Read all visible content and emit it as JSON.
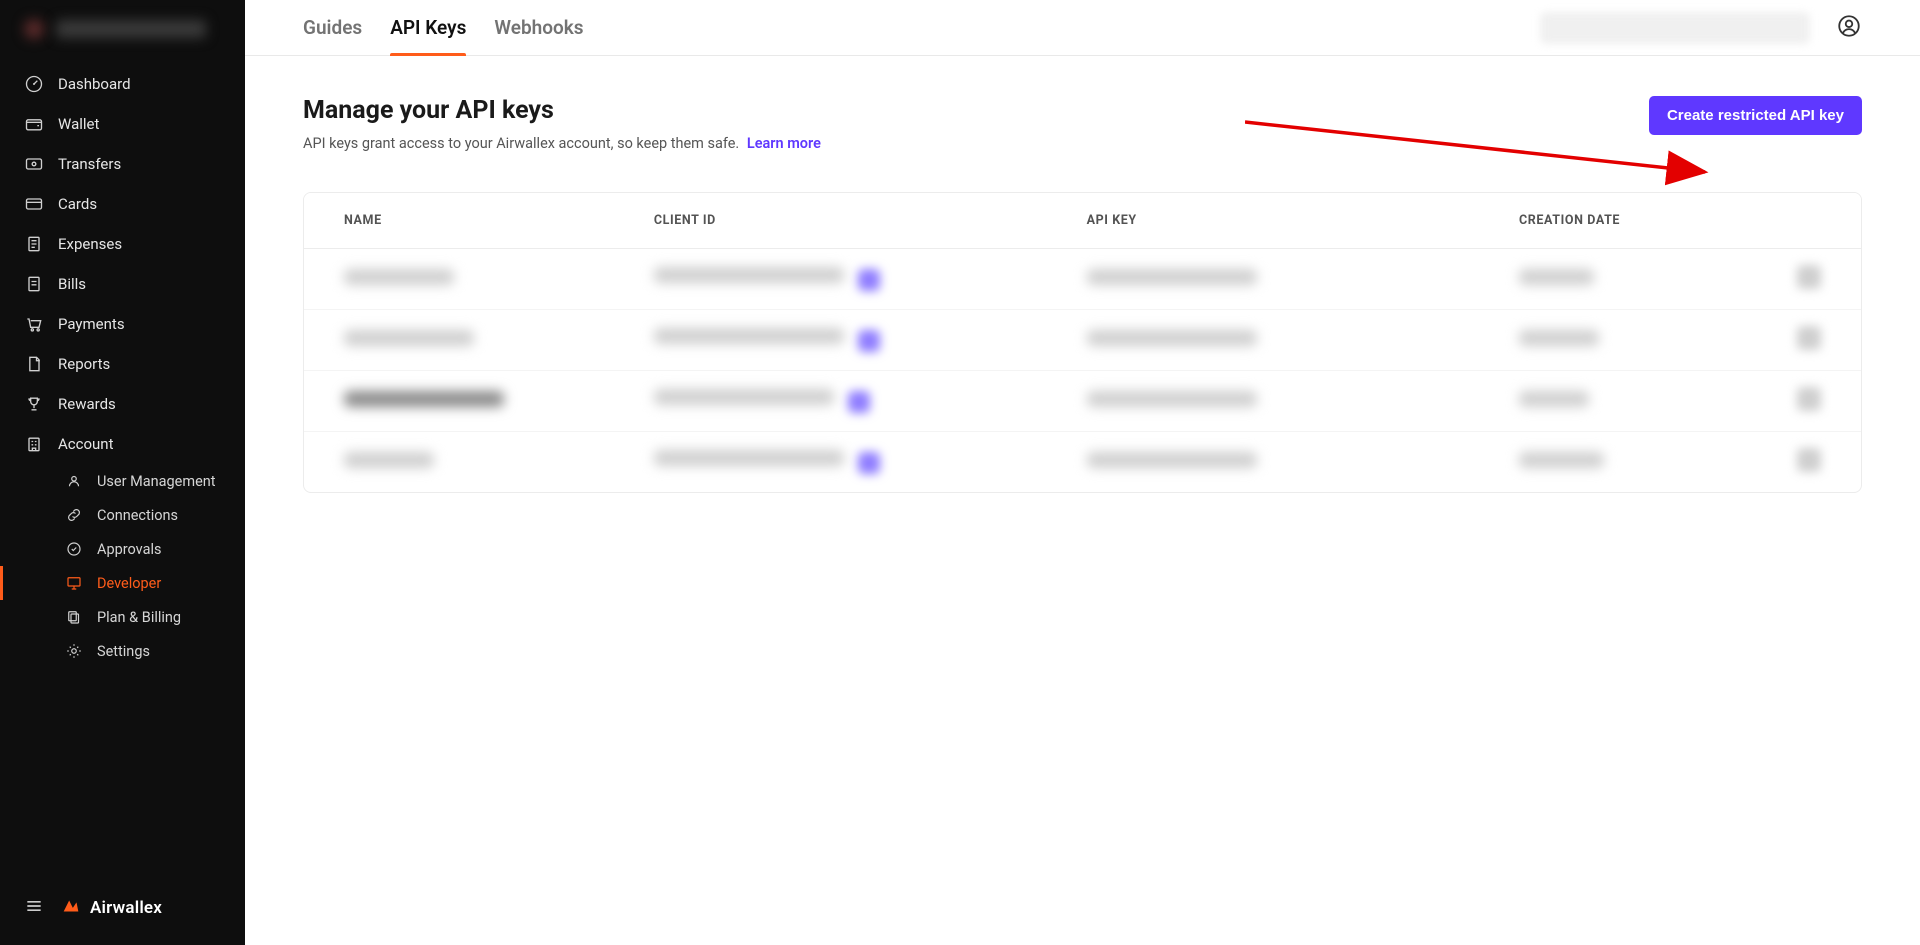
{
  "sidebar": {
    "items": [
      {
        "key": "dashboard",
        "label": "Dashboard"
      },
      {
        "key": "wallet",
        "label": "Wallet"
      },
      {
        "key": "transfers",
        "label": "Transfers"
      },
      {
        "key": "cards",
        "label": "Cards"
      },
      {
        "key": "expenses",
        "label": "Expenses"
      },
      {
        "key": "bills",
        "label": "Bills"
      },
      {
        "key": "payments",
        "label": "Payments"
      },
      {
        "key": "reports",
        "label": "Reports"
      },
      {
        "key": "rewards",
        "label": "Rewards"
      },
      {
        "key": "account",
        "label": "Account"
      }
    ],
    "sub_items": [
      {
        "key": "user-management",
        "label": "User Management"
      },
      {
        "key": "connections",
        "label": "Connections"
      },
      {
        "key": "approvals",
        "label": "Approvals"
      },
      {
        "key": "developer",
        "label": "Developer",
        "active": true
      },
      {
        "key": "plan-billing",
        "label": "Plan & Billing"
      },
      {
        "key": "settings",
        "label": "Settings"
      }
    ],
    "brand": "Airwallex"
  },
  "tabs": [
    {
      "key": "guides",
      "label": "Guides"
    },
    {
      "key": "api-keys",
      "label": "API Keys",
      "active": true
    },
    {
      "key": "webhooks",
      "label": "Webhooks"
    }
  ],
  "page": {
    "title": "Manage your API keys",
    "subtitle": "API keys grant access to your Airwallex account, so keep them safe.",
    "learn_more": "Learn more",
    "create_btn": "Create restricted API key"
  },
  "table": {
    "columns": [
      "NAME",
      "CLIENT ID",
      "API KEY",
      "CREATION DATE"
    ],
    "rows": [
      {
        "name_w": 110,
        "client_w": 190,
        "api_w": 170,
        "date_w": 75,
        "dark": false
      },
      {
        "name_w": 130,
        "client_w": 190,
        "api_w": 170,
        "date_w": 80,
        "dark": false
      },
      {
        "name_w": 160,
        "client_w": 180,
        "api_w": 170,
        "date_w": 70,
        "dark": true
      },
      {
        "name_w": 90,
        "client_w": 190,
        "api_w": 170,
        "date_w": 85,
        "dark": false
      }
    ]
  }
}
